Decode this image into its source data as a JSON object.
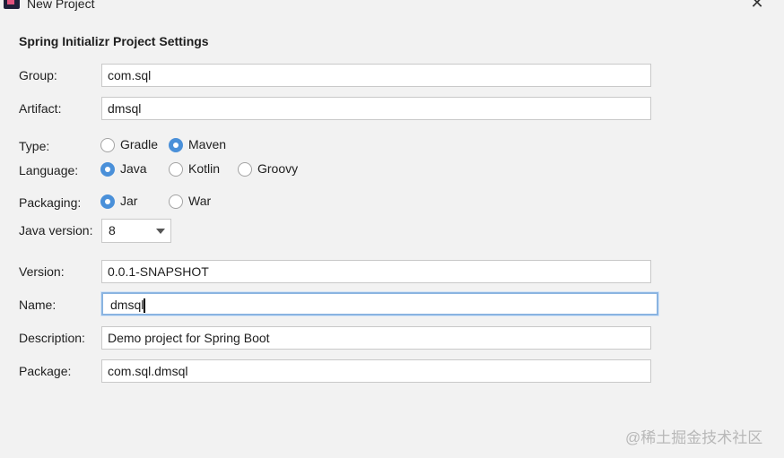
{
  "window": {
    "title": "New Project"
  },
  "section_title": "Spring Initializr Project Settings",
  "labels": {
    "group": "Group:",
    "artifact": "Artifact:",
    "type": "Type:",
    "language": "Language:",
    "packaging": "Packaging:",
    "java_version": "Java version:",
    "version": "Version:",
    "name": "Name:",
    "description": "Description:",
    "package": "Package:"
  },
  "fields": {
    "group": "com.sql",
    "artifact": "dmsql",
    "version": "0.0.1-SNAPSHOT",
    "name": "dmsql",
    "description": "Demo project for Spring Boot",
    "package": "com.sql.dmsql"
  },
  "type_options": [
    {
      "label": "Gradle",
      "checked": false
    },
    {
      "label": "Maven",
      "checked": true
    }
  ],
  "language_options": [
    {
      "label": "Java",
      "checked": true
    },
    {
      "label": "Kotlin",
      "checked": false
    },
    {
      "label": "Groovy",
      "checked": false
    }
  ],
  "packaging_options": [
    {
      "label": "Jar",
      "checked": true
    },
    {
      "label": "War",
      "checked": false
    }
  ],
  "java_version": {
    "selected": "8"
  },
  "watermark": "@稀土掘金技术社区",
  "colors": {
    "accent": "#4a90d9",
    "background": "#f2f2f2",
    "focus_border": "#8ab4e1"
  },
  "icons": {
    "app": "intellij-app-icon",
    "close": "close-icon",
    "dropdown": "chevron-down-icon"
  }
}
